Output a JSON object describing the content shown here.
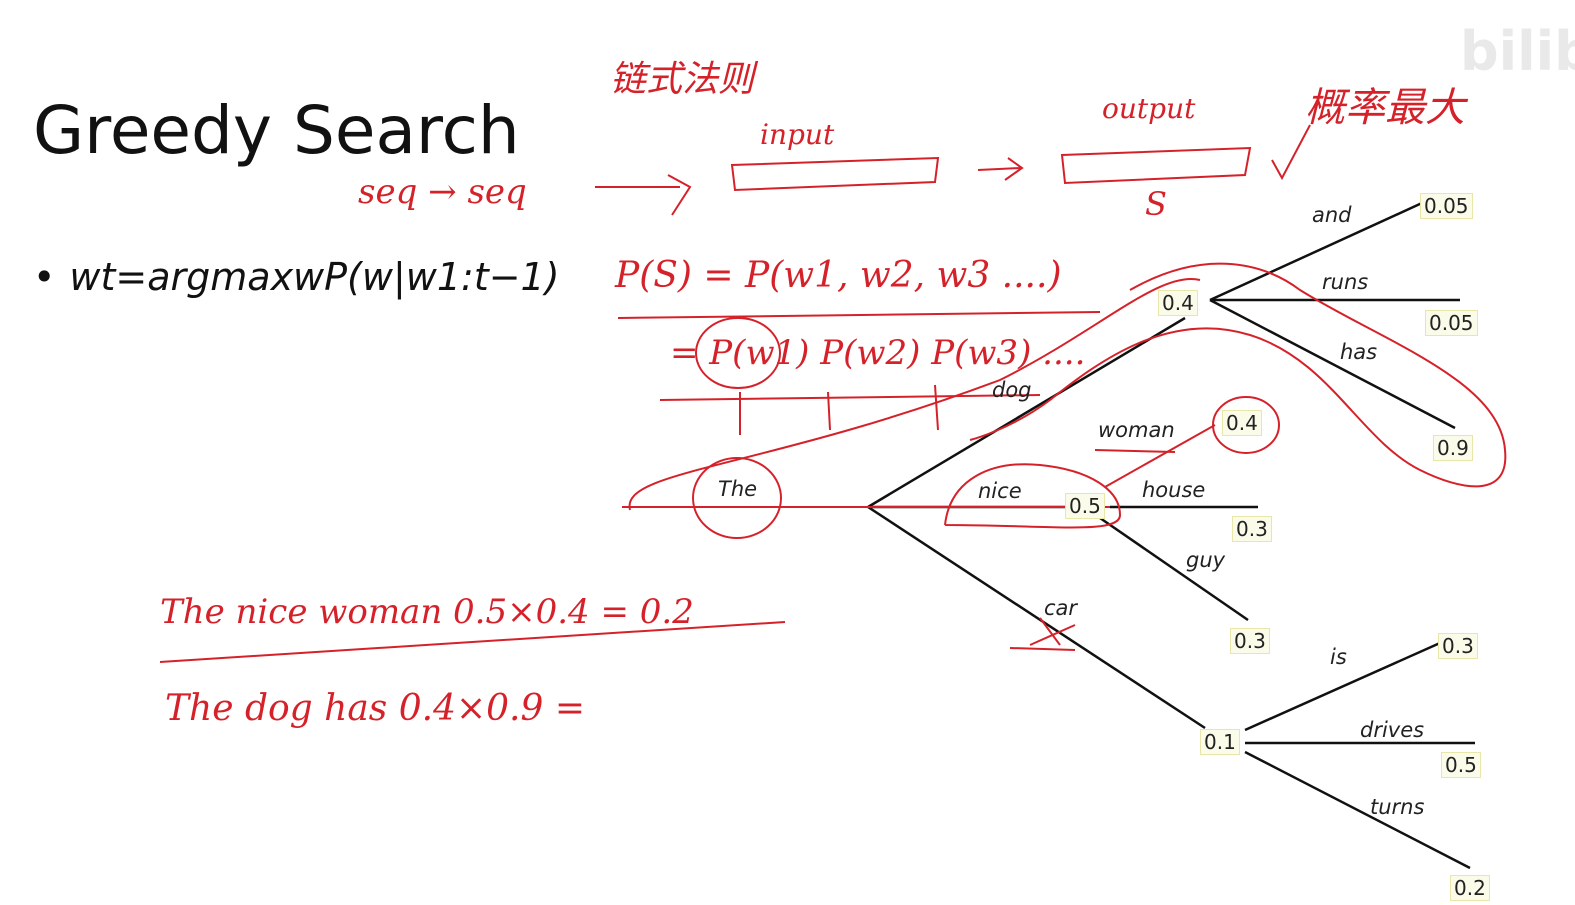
{
  "slide": {
    "title": "Greedy Search",
    "bullet": "wt=argmaxwP(w|w1:t−1)"
  },
  "tree": {
    "root_word": "The",
    "nodes": [
      {
        "word": "dog",
        "prob": "0.4",
        "children": [
          {
            "word": "and",
            "prob": "0.05"
          },
          {
            "word": "runs",
            "prob": "0.05"
          },
          {
            "word": "has",
            "prob": "0.9"
          }
        ]
      },
      {
        "word": "nice",
        "prob": "0.5",
        "children": [
          {
            "word": "woman",
            "prob": "0.4"
          },
          {
            "word": "house",
            "prob": "0.3"
          },
          {
            "word": "guy",
            "prob": "0.3"
          }
        ]
      },
      {
        "word": "car",
        "prob": "0.1",
        "children": [
          {
            "word": "is",
            "prob": "0.3"
          },
          {
            "word": "drives",
            "prob": "0.5"
          },
          {
            "word": "turns",
            "prob": "0.2"
          }
        ]
      }
    ]
  },
  "annotations": {
    "chain_rule": "链式法则",
    "seq2seq": "seq → seq",
    "input": "input",
    "output": "output",
    "s": "S",
    "max_prob": "概率最大",
    "joint": "P(S) = P(w1, w2, w3 ....)",
    "factored": "= P(w1) P(w2) P(w3) ....",
    "line1": "The nice woman   0.5×0.4 = 0.2",
    "line2": "The dog has   0.4×0.9 ="
  },
  "watermark": {
    "logo": "bilibili"
  },
  "colors": {
    "ink": "#d5222a",
    "text": "#111111",
    "box_border": "#e8e6a8"
  }
}
